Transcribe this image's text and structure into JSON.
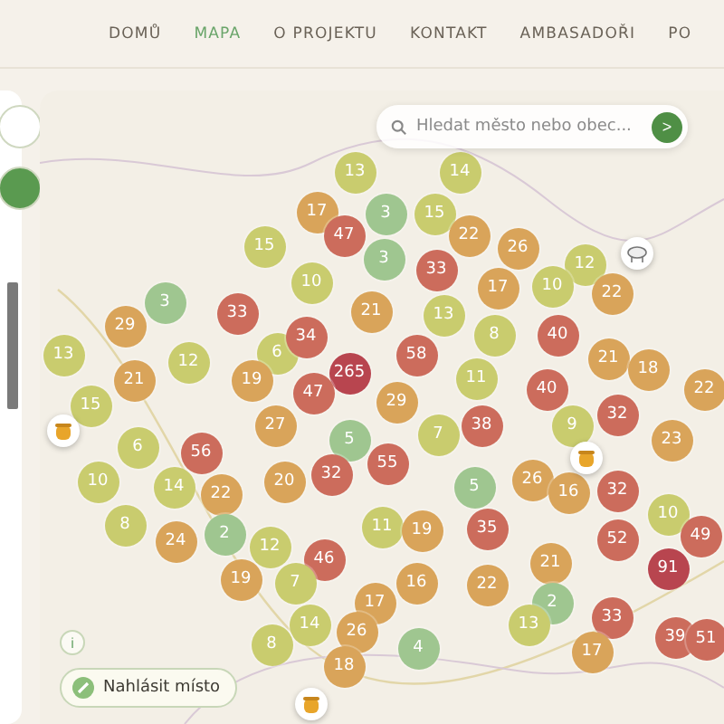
{
  "nav": [
    {
      "label": "DOMŮ",
      "selected": false
    },
    {
      "label": "MAPA",
      "selected": true
    },
    {
      "label": "O PROJEKTU",
      "selected": false
    },
    {
      "label": "KONTAKT",
      "selected": false
    },
    {
      "label": "AMBASADOŘI",
      "selected": false
    },
    {
      "label": "PO",
      "selected": false
    }
  ],
  "search": {
    "placeholder": "Hledat město nebo obec...",
    "button": ">"
  },
  "markers": [
    {
      "count": "13",
      "color": "#c9cc6e"
    },
    {
      "count": "14",
      "color": "#c9cc6e"
    },
    {
      "count": "17",
      "color": "#d9a45a"
    },
    {
      "count": "3",
      "color": "#9fc690"
    },
    {
      "count": "15",
      "color": "#c9cc6e"
    },
    {
      "count": "15",
      "color": "#c9cc6e"
    },
    {
      "count": "47",
      "color": "#cc6c5c"
    },
    {
      "count": "22",
      "color": "#d9a45a"
    },
    {
      "count": "3",
      "color": "#9fc690"
    },
    {
      "count": "26",
      "color": "#d9a45a"
    },
    {
      "count": "12",
      "color": "#c9cc6e"
    },
    {
      "count": "10",
      "color": "#c9cc6e"
    },
    {
      "count": "33",
      "color": "#cc6c5c"
    },
    {
      "count": "17",
      "color": "#d9a45a"
    },
    {
      "count": "10",
      "color": "#c9cc6e"
    },
    {
      "count": "3",
      "color": "#9fc690"
    },
    {
      "count": "21",
      "color": "#d9a45a"
    },
    {
      "count": "22",
      "color": "#d9a45a"
    },
    {
      "count": "29",
      "color": "#d9a45a"
    },
    {
      "count": "33",
      "color": "#cc6c5c"
    },
    {
      "count": "13",
      "color": "#c9cc6e"
    },
    {
      "count": "13",
      "color": "#c9cc6e"
    },
    {
      "count": "6",
      "color": "#c9cc6e"
    },
    {
      "count": "34",
      "color": "#cc6c5c"
    },
    {
      "count": "58",
      "color": "#cc6c5c"
    },
    {
      "count": "8",
      "color": "#c9cc6e"
    },
    {
      "count": "40",
      "color": "#cc6c5c"
    },
    {
      "count": "12",
      "color": "#c9cc6e"
    },
    {
      "count": "265",
      "color": "#b8454f"
    },
    {
      "count": "21",
      "color": "#d9a45a"
    },
    {
      "count": "18",
      "color": "#d9a45a"
    },
    {
      "count": "21",
      "color": "#d9a45a"
    },
    {
      "count": "19",
      "color": "#d9a45a"
    },
    {
      "count": "47",
      "color": "#cc6c5c"
    },
    {
      "count": "11",
      "color": "#c9cc6e"
    },
    {
      "count": "40",
      "color": "#cc6c5c"
    },
    {
      "count": "22",
      "color": "#d9a45a"
    },
    {
      "count": "15",
      "color": "#c9cc6e"
    },
    {
      "count": "29",
      "color": "#d9a45a"
    },
    {
      "count": "32",
      "color": "#cc6c5c"
    },
    {
      "count": "27",
      "color": "#d9a45a"
    },
    {
      "count": "5",
      "color": "#9fc690"
    },
    {
      "count": "7",
      "color": "#c9cc6e"
    },
    {
      "count": "38",
      "color": "#cc6c5c"
    },
    {
      "count": "9",
      "color": "#c9cc6e"
    },
    {
      "count": "23",
      "color": "#d9a45a"
    },
    {
      "count": "6",
      "color": "#c9cc6e"
    },
    {
      "count": "56",
      "color": "#cc6c5c"
    },
    {
      "count": "55",
      "color": "#cc6c5c"
    },
    {
      "count": "10",
      "color": "#c9cc6e"
    },
    {
      "count": "20",
      "color": "#d9a45a"
    },
    {
      "count": "32",
      "color": "#cc6c5c"
    },
    {
      "count": "26",
      "color": "#d9a45a"
    },
    {
      "count": "14",
      "color": "#c9cc6e"
    },
    {
      "count": "22",
      "color": "#d9a45a"
    },
    {
      "count": "5",
      "color": "#9fc690"
    },
    {
      "count": "16",
      "color": "#d9a45a"
    },
    {
      "count": "32",
      "color": "#cc6c5c"
    },
    {
      "count": "8",
      "color": "#c9cc6e"
    },
    {
      "count": "11",
      "color": "#c9cc6e"
    },
    {
      "count": "35",
      "color": "#cc6c5c"
    },
    {
      "count": "10",
      "color": "#c9cc6e"
    },
    {
      "count": "24",
      "color": "#d9a45a"
    },
    {
      "count": "2",
      "color": "#9fc690"
    },
    {
      "count": "12",
      "color": "#c9cc6e"
    },
    {
      "count": "19",
      "color": "#d9a45a"
    },
    {
      "count": "52",
      "color": "#cc6c5c"
    },
    {
      "count": "49",
      "color": "#cc6c5c"
    },
    {
      "count": "46",
      "color": "#cc6c5c"
    },
    {
      "count": "21",
      "color": "#d9a45a"
    },
    {
      "count": "91",
      "color": "#b8454f"
    },
    {
      "count": "19",
      "color": "#d9a45a"
    },
    {
      "count": "7",
      "color": "#c9cc6e"
    },
    {
      "count": "16",
      "color": "#d9a45a"
    },
    {
      "count": "22",
      "color": "#d9a45a"
    },
    {
      "count": "17",
      "color": "#d9a45a"
    },
    {
      "count": "2",
      "color": "#9fc690"
    },
    {
      "count": "14",
      "color": "#c9cc6e"
    },
    {
      "count": "26",
      "color": "#d9a45a"
    },
    {
      "count": "13",
      "color": "#c9cc6e"
    },
    {
      "count": "33",
      "color": "#cc6c5c"
    },
    {
      "count": "39",
      "color": "#cc6c5c"
    },
    {
      "count": "8",
      "color": "#c9cc6e"
    },
    {
      "count": "4",
      "color": "#9fc690"
    },
    {
      "count": "17",
      "color": "#d9a45a"
    },
    {
      "count": "51",
      "color": "#cc6c5c"
    },
    {
      "count": "18",
      "color": "#d9a45a"
    }
  ],
  "info_button": "i",
  "report_button": "Nahlásit místo"
}
